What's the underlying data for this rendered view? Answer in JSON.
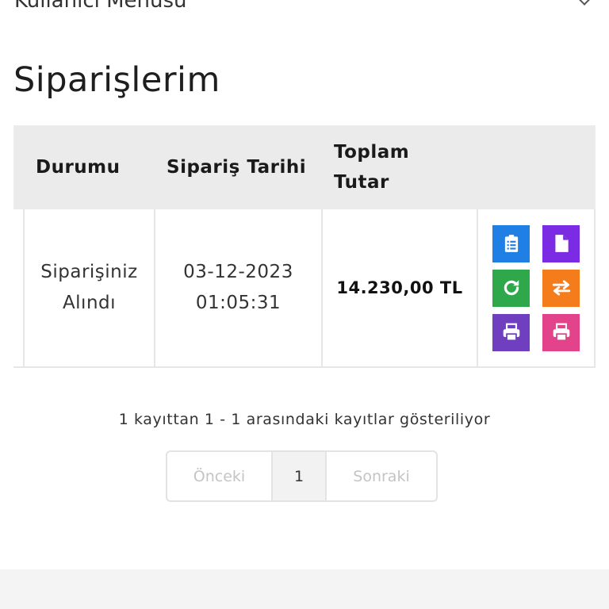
{
  "menu": {
    "label": "Kullanıcı Menüsü"
  },
  "page_title": "Siparişlerim",
  "table": {
    "headers": {
      "status": "Durumu",
      "date": "Sipariş Tarihi",
      "total_line1": "Toplam",
      "total_line2": "Tutar"
    },
    "rows": [
      {
        "status_line1": "Siparişiniz",
        "status_line2": "Alındı",
        "date_line1": "03-12-2023",
        "date_line2": "01:05:31",
        "total": "14.230,00 TL"
      }
    ],
    "actions": [
      {
        "icon": "clipboard-list-icon",
        "color": "#1f7fe5"
      },
      {
        "icon": "file-icon",
        "color": "#7b2be3"
      },
      {
        "icon": "refresh-icon",
        "color": "#2ea84a"
      },
      {
        "icon": "exchange-icon",
        "color": "#f57c1a"
      },
      {
        "icon": "print-icon",
        "color": "#6f3fc0"
      },
      {
        "icon": "print-icon",
        "color": "#e2438b"
      }
    ]
  },
  "records_info": "1 kayıttan 1 - 1 arasındaki kayıtlar gösteriliyor",
  "pagination": {
    "prev": "Önceki",
    "current": "1",
    "next": "Sonraki"
  }
}
